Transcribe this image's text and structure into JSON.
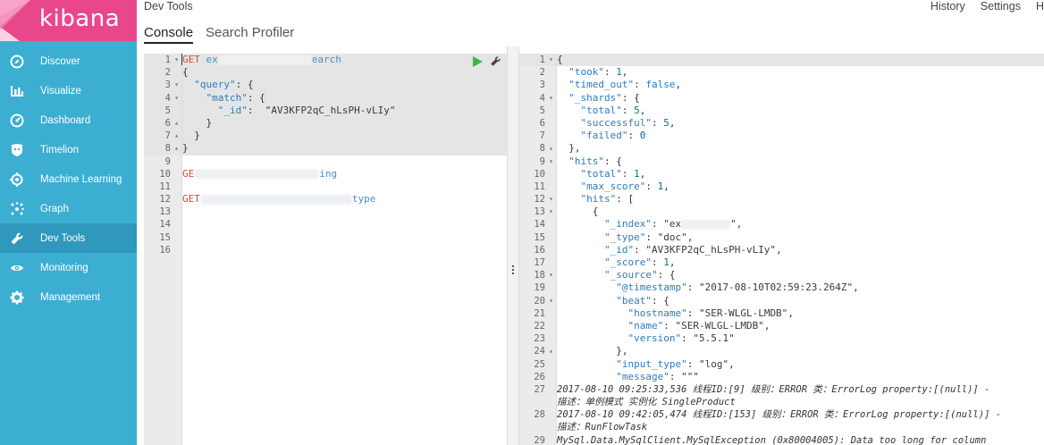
{
  "brand": {
    "name": "kibana",
    "color": "#e8488b",
    "sidebar_color": "#3caed2"
  },
  "sidebar": {
    "items": [
      {
        "label": "Discover",
        "icon": "compass-icon"
      },
      {
        "label": "Visualize",
        "icon": "bar-chart-icon"
      },
      {
        "label": "Dashboard",
        "icon": "gauge-icon"
      },
      {
        "label": "Timelion",
        "icon": "shield-icon"
      },
      {
        "label": "Machine Learning",
        "icon": "ml-icon"
      },
      {
        "label": "Graph",
        "icon": "graph-icon"
      },
      {
        "label": "Dev Tools",
        "icon": "wrench-icon"
      },
      {
        "label": "Monitoring",
        "icon": "eye-icon"
      },
      {
        "label": "Management",
        "icon": "gear-icon"
      }
    ],
    "active": "Dev Tools"
  },
  "header": {
    "title": "Dev Tools",
    "links": [
      "History",
      "Settings",
      "H"
    ],
    "tabs": [
      "Console",
      "Search Profiler"
    ]
  },
  "console": {
    "line_numbers": [
      "1",
      "2",
      "3",
      "4",
      "5",
      "6",
      "7",
      "8",
      "9",
      "10",
      "11",
      "12",
      "13",
      "14",
      "15",
      "16"
    ],
    "l1_method": "GET",
    "l1_index": "ex",
    "l1_endpoint": "earch",
    "l2": "{",
    "l3_key": "\"query\"",
    "l4_key": "\"match\"",
    "l5_key": "\"_id\"",
    "l5_val": "\"AV3KFP2qC_hLsPH-vLIy\"",
    "l6": "}",
    "l7": "}",
    "l8": "}",
    "l10_method": "GE",
    "l10_suffix": "ing",
    "l12_method": "GET",
    "l12_suffix": "type"
  },
  "response": {
    "line_numbers": [
      "1",
      "2",
      "3",
      "4",
      "5",
      "6",
      "7",
      "8",
      "9",
      "10",
      "11",
      "12",
      "13",
      "14",
      "15",
      "16",
      "17",
      "18",
      "19",
      "20",
      "21",
      "22",
      "23",
      "24",
      "25",
      "26",
      "27",
      "",
      "28",
      "",
      "29"
    ],
    "took": "1",
    "timed_out": "false",
    "shards_total": "5",
    "shards_successful": "5",
    "shards_failed": "0",
    "hits_total": "1",
    "max_score": "1",
    "index_prefix": "ex",
    "type": "\"doc\"",
    "id": "\"AV3KFP2qC_hLsPH-vLIy\"",
    "score": "1",
    "timestamp": "\"2017-08-10T02:59:23.264Z\"",
    "hostname": "\"SER-WLGL-LMDB\"",
    "name": "\"SER-WLGL-LMDB\"",
    "version": "\"5.5.1\"",
    "input_type": "\"log\"",
    "message": "\"\"\"",
    "log27a": "2017-08-10 09:25:33,536 线程ID:[9] 级别：ERROR 类：ErrorLog property:[(null)] -",
    "log27b": "描述：单例模式 实例化 SingleProduct",
    "log28a": "2017-08-10 09:42:05,474 线程ID:[153] 级别：ERROR 类：ErrorLog property:[(null)] -",
    "log28b": "描述：RunFlowTask",
    "log29a": "MySql.Data.MySqlClient.MySqlException (0x80004005): Data too long for column"
  }
}
